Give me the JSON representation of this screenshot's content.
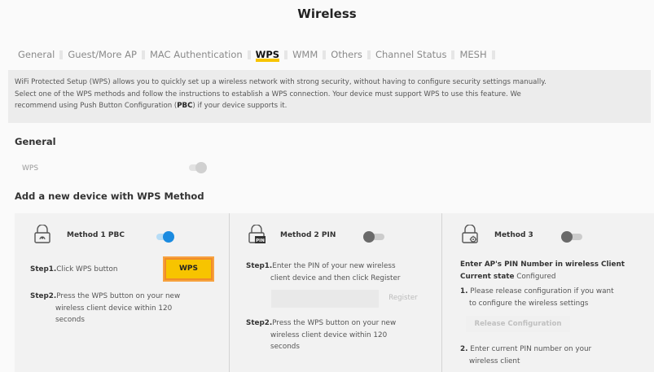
{
  "page": {
    "title": "Wireless"
  },
  "tabs": [
    {
      "label": "General"
    },
    {
      "label": "Guest/More AP"
    },
    {
      "label": "MAC Authentication"
    },
    {
      "label": "WPS",
      "active": true
    },
    {
      "label": "WMM"
    },
    {
      "label": "Others"
    },
    {
      "label": "Channel Status"
    },
    {
      "label": "MESH"
    }
  ],
  "info": {
    "line1": "WiFi Protected Setup (WPS) allows you to quickly set up a wireless network with strong security, without having to configure security settings manually.",
    "line2": "Select one of the WPS methods and follow the instructions to establish a WPS connection. Your device must support WPS to use this feature. We",
    "line3_pre": "recommend using Push Button Configuration (",
    "line3_bold": "PBC",
    "line3_post": ") if your device supports it."
  },
  "general": {
    "title": "General",
    "wps_label": "WPS",
    "wps_enabled": true
  },
  "add_device": {
    "title": "Add a new device with WPS Method"
  },
  "method1": {
    "title": "Method 1 PBC",
    "enabled": true,
    "step1_label": "Step1.",
    "step1_text": "Click WPS button",
    "wps_button": "WPS",
    "step2_label": "Step2.",
    "step2_line1": "Press the WPS button on your new",
    "step2_line2": "wireless client device within 120",
    "step2_line3": "seconds"
  },
  "method2": {
    "title": "Method 2 PIN",
    "enabled": false,
    "step1_label": "Step1.",
    "step1_line1": "Enter the PIN of your new wireless",
    "step1_line2": "client device and then click Register",
    "pin_value": "",
    "register_button": "Register",
    "step2_label": "Step2.",
    "step2_line1": "Press the WPS button on your new",
    "step2_line2": "wireless client device within 120",
    "step2_line3": "seconds"
  },
  "method3": {
    "title": "Method 3",
    "enabled": false,
    "heading": "Enter AP's PIN Number in wireless Client",
    "state_label": "Current state",
    "state_value": "Configured",
    "item1_num": "1.",
    "item1_line1": "Please release configuration if you want",
    "item1_line2": "to configure the wireless settings",
    "release_button": "Release Configuration",
    "item2_num": "2.",
    "item2_line1": "Enter current PIN number on your",
    "item2_line2": "wireless client"
  },
  "icons": {
    "method1": "push-button-icon",
    "method2": "pin-icon",
    "method3": "gear-lock-icon"
  },
  "colors": {
    "accent": "#f7c400",
    "highlight": "#f08c2a",
    "toggle_on": "#1b8be0"
  }
}
